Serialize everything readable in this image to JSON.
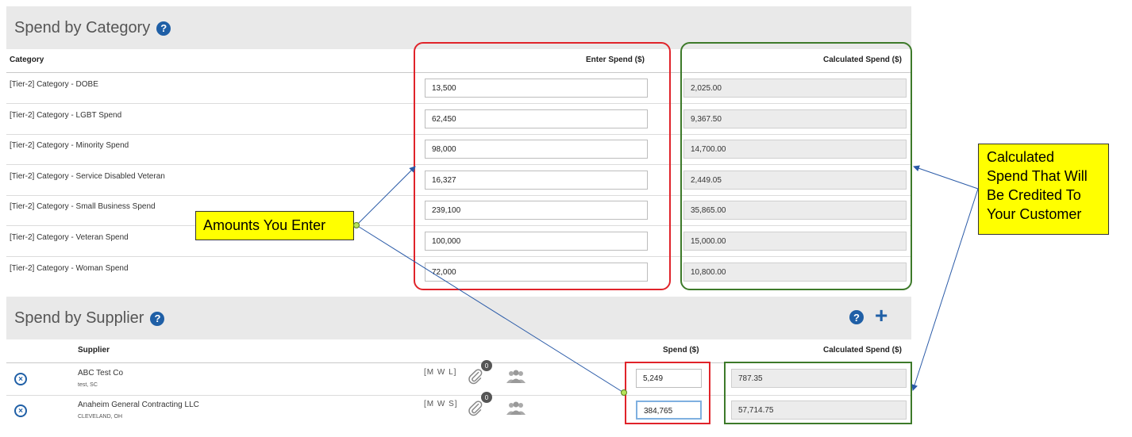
{
  "category_section": {
    "title": "Spend by Category",
    "col_category": "Category",
    "col_enter": "Enter Spend ($)",
    "col_calc": "Calculated Spend ($)",
    "rows": [
      {
        "label": "[Tier-2] Category - DOBE",
        "enter": "13,500",
        "calc": "2,025.00"
      },
      {
        "label": "[Tier-2] Category - LGBT Spend",
        "enter": "62,450",
        "calc": "9,367.50"
      },
      {
        "label": "[Tier-2] Category - Minority Spend",
        "enter": "98,000",
        "calc": "14,700.00"
      },
      {
        "label": "[Tier-2] Category - Service Disabled Veteran",
        "enter": "16,327",
        "calc": "2,449.05"
      },
      {
        "label": "[Tier-2] Category - Small Business Spend",
        "enter": "239,100",
        "calc": "35,865.00"
      },
      {
        "label": "[Tier-2] Category - Veteran Spend",
        "enter": "100,000",
        "calc": "15,000.00"
      },
      {
        "label": "[Tier-2] Category - Woman Spend",
        "enter": "72,000",
        "calc": "10,800.00"
      }
    ]
  },
  "supplier_section": {
    "title": "Spend by Supplier",
    "col_supplier": "Supplier",
    "col_spend": "Spend ($)",
    "col_calc": "Calculated Spend ($)",
    "rows": [
      {
        "name": "ABC Test Co",
        "location": "test, SC",
        "tags": "[M W L]",
        "attachments": "0",
        "spend": "5,249",
        "calc": "787.35"
      },
      {
        "name": "Anaheim General Contracting LLC",
        "location": "CLEVELAND, OH",
        "tags": "[M W S]",
        "attachments": "0",
        "spend": "384,765",
        "calc": "57,714.75"
      }
    ]
  },
  "callouts": {
    "amounts": "Amounts You Enter",
    "calculated": [
      "Calculated",
      "Spend That Will",
      "Be Credited To",
      "Your Customer"
    ]
  },
  "icons": {
    "help": "question-circle-icon",
    "add": "plus-icon",
    "remove": "close-circle-icon",
    "attachment": "paperclip-icon",
    "contacts": "users-icon"
  },
  "colors": {
    "accent": "#1f5fa6",
    "highlight_red": "#e0232a",
    "highlight_green": "#3d7a2a",
    "callout_bg": "#ffff00",
    "header_bg": "#e9e9e9"
  }
}
